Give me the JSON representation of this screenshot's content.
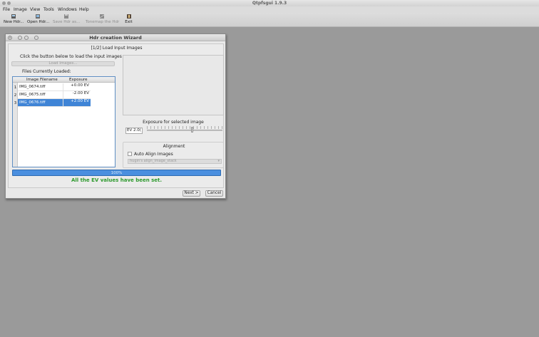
{
  "app": {
    "title": "Qtpfsgui 1.9.3"
  },
  "menu": [
    "File",
    "Image",
    "View",
    "Tools",
    "Windows",
    "Help"
  ],
  "toolbar": [
    {
      "label": "New Hdr...",
      "icon": "new-hdr-icon",
      "enabled": true
    },
    {
      "label": "Open Hdr...",
      "icon": "open-hdr-icon",
      "enabled": true
    },
    {
      "label": "Save Hdr as...",
      "icon": "save-icon",
      "enabled": false
    },
    {
      "label": "Tonemap the Hdr",
      "icon": "tonemap-icon",
      "enabled": false
    },
    {
      "label": "Exit",
      "icon": "exit-icon",
      "enabled": true
    }
  ],
  "dialog": {
    "title": "Hdr creation Wizard",
    "section_title": "[1/2] Load Input Images",
    "click_message": "Click the button below to load the input images",
    "load_button": "Load Images...",
    "files_label": "Files Currently Loaded:",
    "table": {
      "columns": [
        "Image Filename",
        "Exposure"
      ],
      "rows": [
        {
          "num": "1",
          "filename": "IMG_0674.tiff",
          "exposure": "+0.00 EV"
        },
        {
          "num": "2",
          "filename": "IMG_0675.tiff",
          "exposure": "-2.00 EV"
        },
        {
          "num": "3",
          "filename": "IMG_0676.tiff",
          "exposure": "+2.00 EV",
          "selected": true
        }
      ]
    },
    "exposure_label": "Exposure for selected image",
    "ev_spin": "EV 2.0(",
    "exposure_slider_fraction": 0.6,
    "alignment_title": "Alignment",
    "auto_align_label": "Auto Align Images",
    "align_method": "hugin's align_image_stack",
    "progress": "100%",
    "progress_fraction": 1.0,
    "status": "All the EV values have been set.",
    "next_button": "Next >",
    "cancel_button": "Cancel"
  },
  "colors": {
    "selection": "#3f84d6",
    "progress": "#4a8fdf",
    "status_text": "#2f9a2f"
  }
}
